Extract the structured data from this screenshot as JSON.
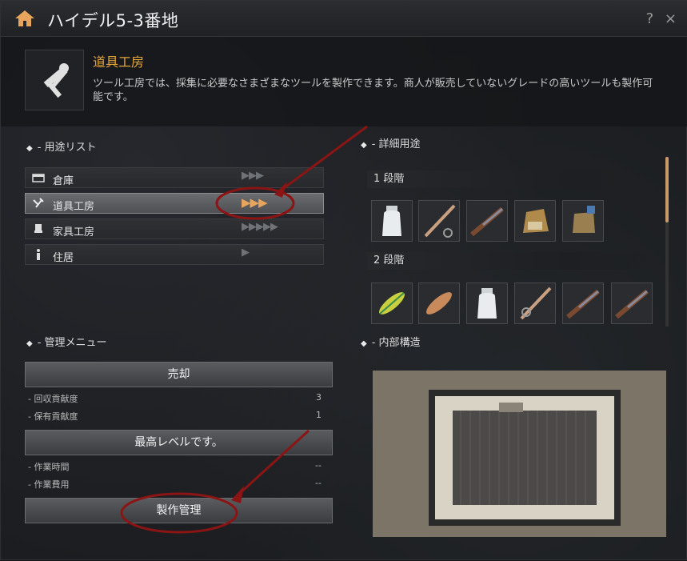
{
  "window": {
    "title": "ハイデル5-3番地",
    "help_label": "?",
    "close_label": "×"
  },
  "header": {
    "title": "道具工房",
    "description": "ツール工房では、採集に必要なさまざまなツールを製作できます。商人が販売していないグレードの高いツールも製作可能です。"
  },
  "use_list": {
    "section_label": "- 用途リスト",
    "items": [
      {
        "label": "倉庫",
        "icon": "storage-icon",
        "arrows": "▶▶▶"
      },
      {
        "label": "道具工房",
        "icon": "tool-workshop-icon",
        "arrows": "▶▶▶"
      },
      {
        "label": "家具工房",
        "icon": "furniture-icon",
        "arrows": "▶▶▶▶▶"
      },
      {
        "label": "住居",
        "icon": "residence-icon",
        "arrows": "▶"
      }
    ]
  },
  "detail": {
    "section_label": "- 詳細用途",
    "stages": [
      {
        "label": "1 段階",
        "items": [
          "bottle-icon",
          "fishing-rod-icon",
          "musket-icon",
          "gold-ore-icon",
          "loot-bag-icon"
        ]
      },
      {
        "label": "2 段階",
        "items": [
          "float-icon",
          "wooden-float-icon",
          "empty-bottle-icon",
          "fishing-rod-icon",
          "musket-icon",
          "musket-icon"
        ]
      }
    ]
  },
  "management": {
    "section_label": "- 管理メニュー",
    "sell_label": "売却",
    "recovery_label": "- 回収貢献度",
    "recovery_value": "3",
    "held_label": "- 保有貢献度",
    "held_value": "1",
    "max_level_label": "最高レベルです。",
    "work_time_label": "- 作業時間",
    "work_time_value": "--",
    "work_cost_label": "- 作業費用",
    "work_cost_value": "--",
    "craft_label": "製作管理"
  },
  "interior": {
    "section_label": "- 内部構造"
  },
  "colors": {
    "accent": "#e5a63a",
    "annotation": "#8b1414",
    "scroll_thumb": "#c89a6a"
  }
}
